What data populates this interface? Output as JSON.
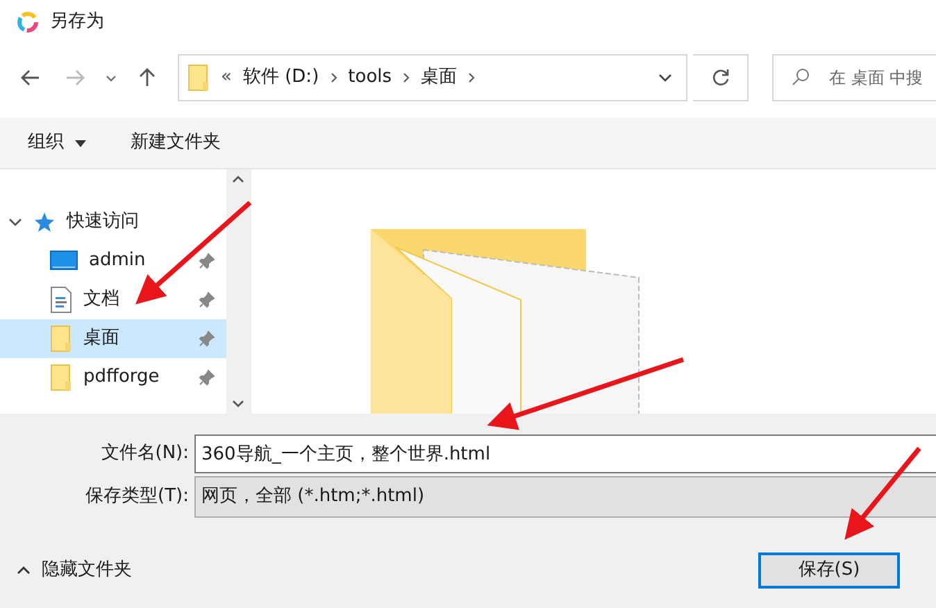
{
  "window": {
    "title": "另存为"
  },
  "address_bar": {
    "overflow": "«",
    "path": [
      "软件 (D:)",
      "tools",
      "桌面"
    ]
  },
  "search": {
    "placeholder": "在 桌面 中搜"
  },
  "toolbar": {
    "organize": "组织",
    "new_folder": "新建文件夹"
  },
  "sidebar": {
    "group": {
      "label": "快速访问",
      "expanded": true
    },
    "items": [
      {
        "label": "admin",
        "kind": "desktop",
        "selected": false
      },
      {
        "label": "文档",
        "kind": "document",
        "selected": false
      },
      {
        "label": "桌面",
        "kind": "folder",
        "selected": true
      },
      {
        "label": "pdfforge",
        "kind": "folder",
        "selected": false
      }
    ]
  },
  "form": {
    "filename_label": "文件名(N):",
    "filename": "360导航_一个主页，整个世界.html",
    "type_label": "保存类型(T):",
    "type": "网页，全部 (*.htm;*.html)"
  },
  "footer": {
    "hide_folders": "隐藏文件夹",
    "save": "保存(S)"
  }
}
